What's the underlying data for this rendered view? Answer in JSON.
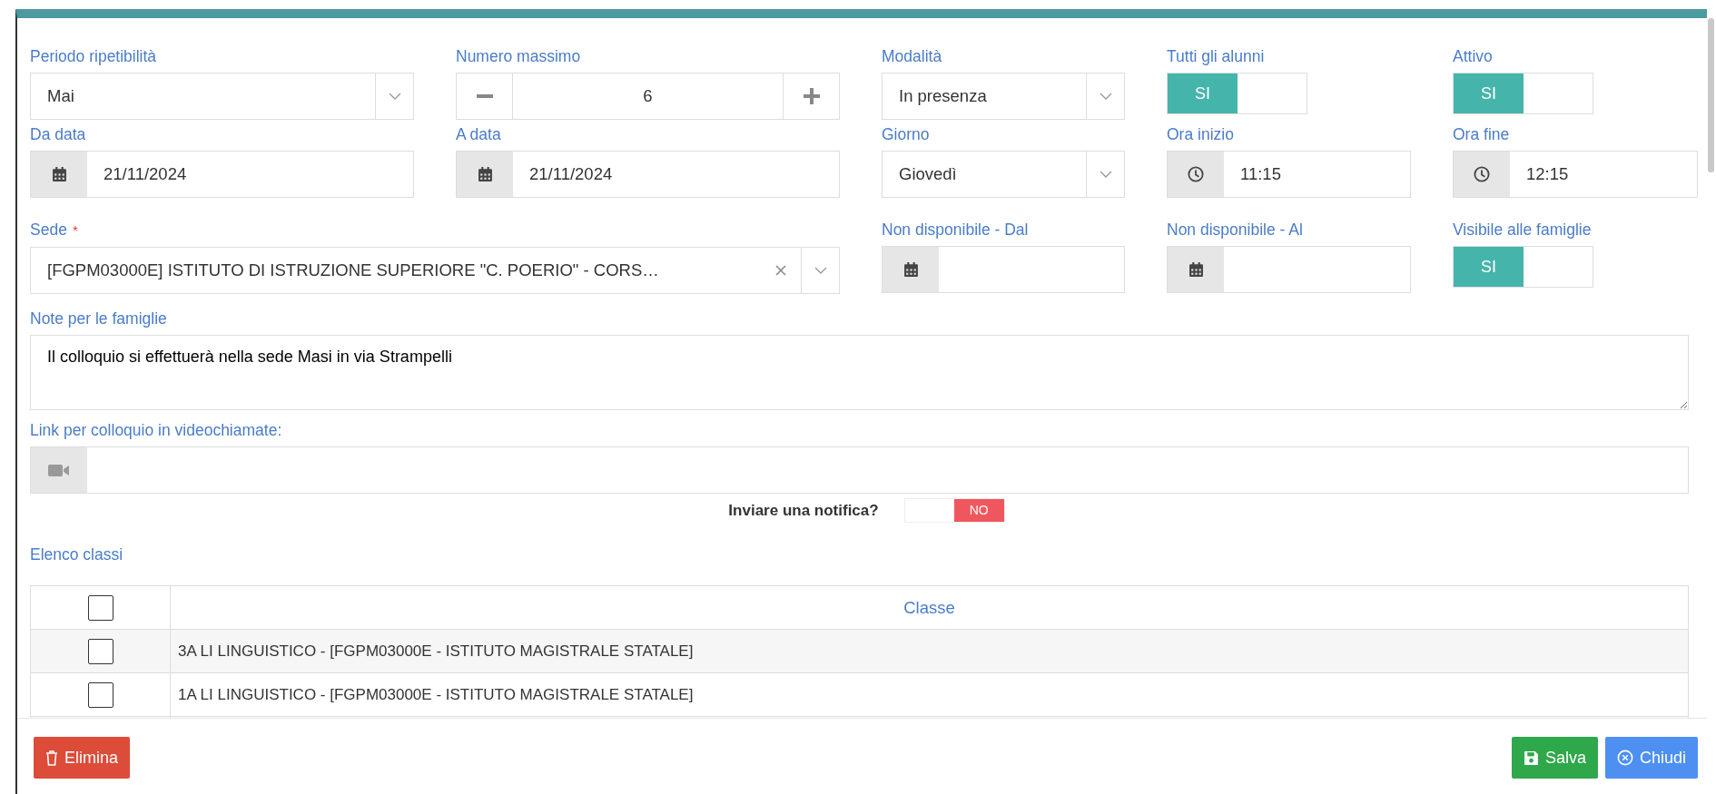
{
  "form_rows": [
    [
      {
        "kind": "select",
        "label": "Periodo ripetibilità",
        "value": "Mai"
      },
      {
        "kind": "spinner",
        "label": "Numero massimo",
        "value": "6"
      },
      {
        "kind": "select",
        "label": "Modalità",
        "value": "In presenza"
      },
      {
        "kind": "toggle",
        "label": "Tutti gli alunni",
        "on": true,
        "value_label": "SI"
      },
      {
        "kind": "toggle",
        "label": "Attivo",
        "on": true,
        "value_label": "SI"
      }
    ],
    [
      {
        "kind": "date",
        "label": "Da data",
        "value": "21/11/2024"
      },
      {
        "kind": "date",
        "label": "A data",
        "value": "21/11/2024"
      },
      {
        "kind": "select",
        "label": "Giorno",
        "value": "Giovedì"
      },
      {
        "kind": "time",
        "label": "Ora inizio",
        "value": "11:15"
      },
      {
        "kind": "time",
        "label": "Ora fine",
        "value": "12:15"
      }
    ],
    [
      {
        "kind": "combo",
        "label": "Sede",
        "required_mark": "*",
        "value": "[FGPM03000E] ISTITUTO DI ISTRUZIONE SUPERIORE \"C. POERIO\" - CORS…"
      },
      {
        "kind": "date",
        "label": "Non disponibile - Dal"
      },
      {
        "kind": "date",
        "label": "Non disponibile - Al"
      },
      {
        "kind": "toggle",
        "label": "Visibile alle famiglie",
        "on": true,
        "value_label": "SI"
      }
    ]
  ],
  "notes": {
    "label": "Note per le famiglie",
    "value": "Il colloquio si effettuerà nella sede Masi in via Strampelli"
  },
  "video_link": {
    "label": "Link per colloquio in videochiamate:"
  },
  "notification": {
    "label": "Inviare una notifica?",
    "on": false,
    "value_label": "NO"
  },
  "classes": {
    "title": "Elenco classi",
    "column": "Classe",
    "header_checked": false,
    "rows": [
      {
        "text": "3A LI LINGUISTICO - [FGPM03000E - ISTITUTO MAGISTRALE STATALE]",
        "checked": false
      },
      {
        "text": "1A LI LINGUISTICO - [FGPM03000E - ISTITUTO MAGISTRALE STATALE]",
        "checked": false
      }
    ]
  },
  "buttons": [
    {
      "kind": "delete",
      "label": "Elimina"
    },
    {
      "kind": "save",
      "label": "Salva"
    },
    {
      "kind": "close",
      "label": "Chiudi"
    }
  ]
}
